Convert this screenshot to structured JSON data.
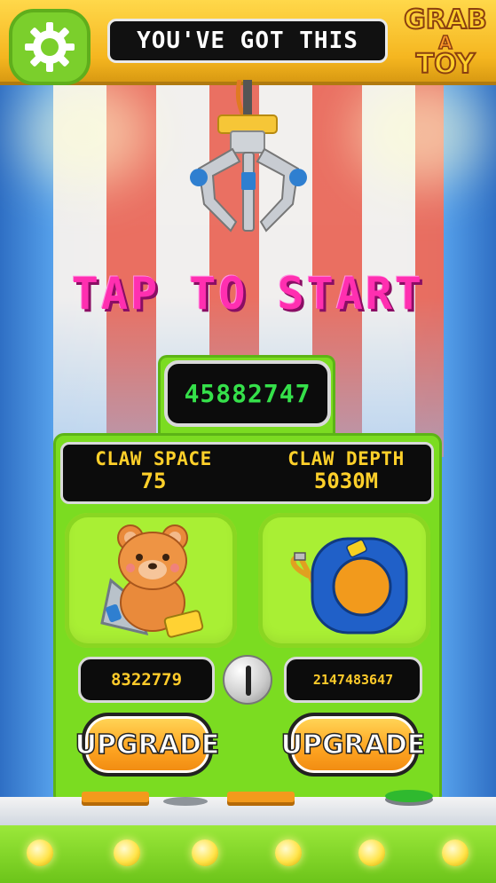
{
  "header": {
    "banner_text": "YOU'VE GOT THIS",
    "logo_lines": [
      "GRAB",
      "A",
      "TOY"
    ],
    "settings_icon": "gear-icon"
  },
  "prompt": {
    "text": "TAP TO START"
  },
  "score": {
    "value": "45882747"
  },
  "stats": {
    "claw_space_label": "CLAW SPACE",
    "claw_space_value": "75",
    "claw_depth_label": "CLAW DEPTH",
    "claw_depth_value": "5030M"
  },
  "upgrades": {
    "left": {
      "icon": "teddy-bear-icon",
      "price": "8322779",
      "button_label": "UPGRADE"
    },
    "right": {
      "icon": "tape-measure-icon",
      "price": "2147483647",
      "button_label": "UPGRADE"
    }
  },
  "coin_slot_icon": "coin-slot-icon",
  "colors": {
    "accent_green": "#7bdc21",
    "score_green": "#35e04a",
    "stat_yellow": "#ffd02a",
    "prompt_pink": "#ff2fb0",
    "button_orange": "#ffa623"
  }
}
